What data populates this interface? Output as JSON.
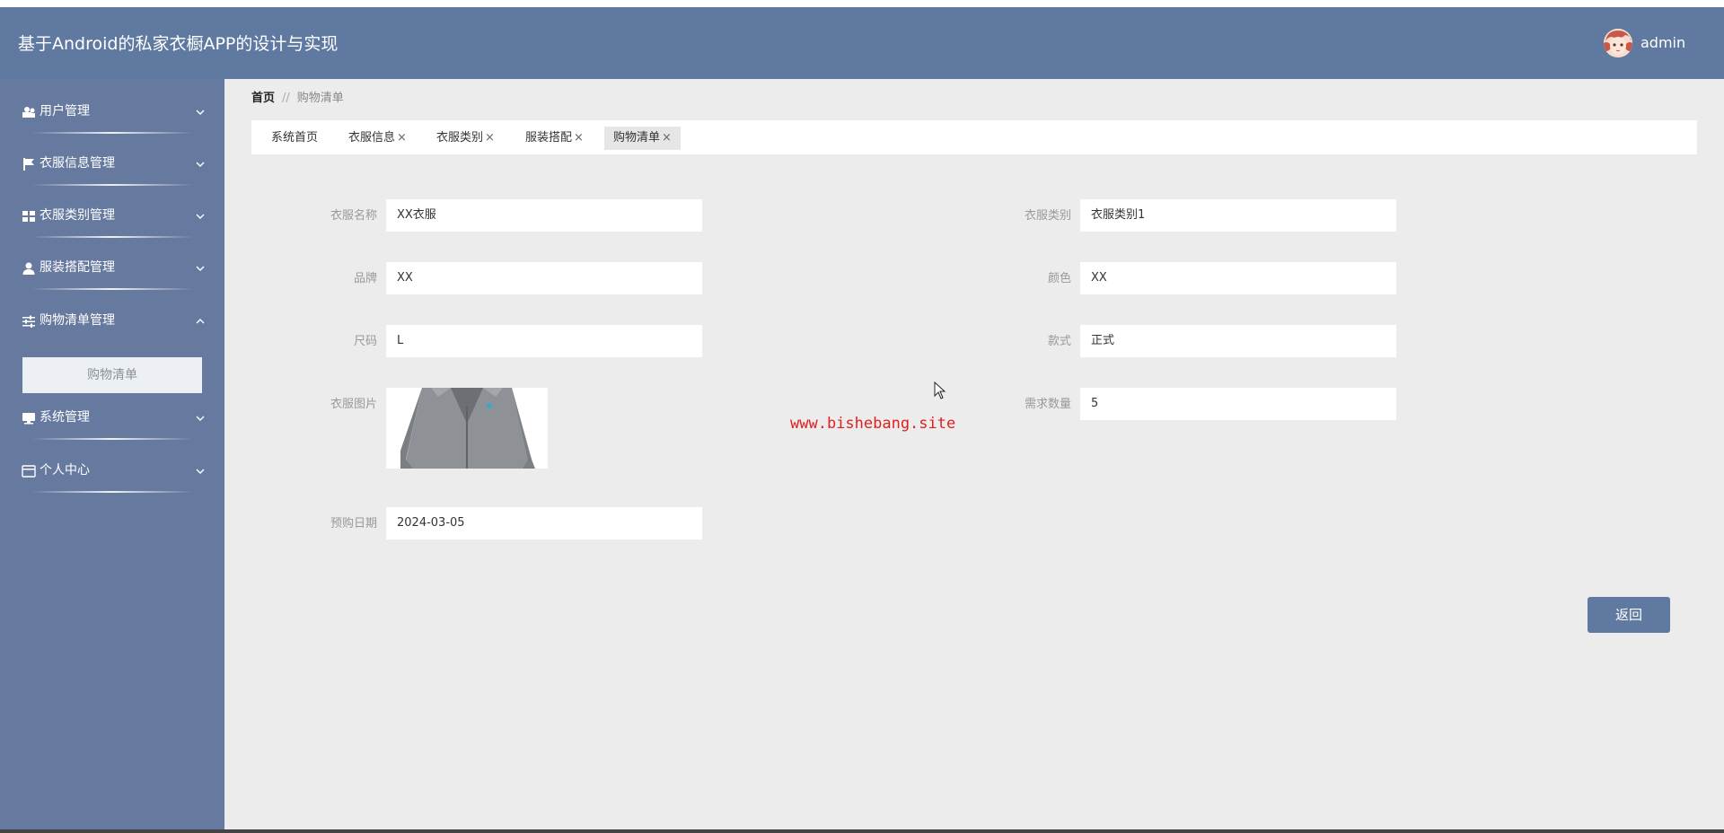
{
  "app": {
    "title": "基于Android的私家衣橱APP的设计与实现",
    "user": "admin"
  },
  "sidebar": {
    "items": [
      {
        "label": "用户管理",
        "icon": "user-group-icon",
        "expanded": false
      },
      {
        "label": "衣服信息管理",
        "icon": "flag-icon",
        "expanded": false
      },
      {
        "label": "衣服类别管理",
        "icon": "grid-icon",
        "expanded": false
      },
      {
        "label": "服装搭配管理",
        "icon": "person-icon",
        "expanded": false
      },
      {
        "label": "购物清单管理",
        "icon": "sliders-icon",
        "expanded": true
      },
      {
        "label": "系统管理",
        "icon": "monitor-icon",
        "expanded": false
      },
      {
        "label": "个人中心",
        "icon": "card-icon",
        "expanded": false
      }
    ],
    "submenu": {
      "label": "购物清单"
    }
  },
  "breadcrumb": {
    "home": "首页",
    "separator": "//",
    "current": "购物清单"
  },
  "tabs": [
    {
      "label": "系统首页",
      "closable": false
    },
    {
      "label": "衣服信息",
      "closable": true
    },
    {
      "label": "衣服类别",
      "closable": true
    },
    {
      "label": "服装搭配",
      "closable": true
    },
    {
      "label": "购物清单",
      "closable": true,
      "active": true
    }
  ],
  "tab_close_glyph": "×",
  "form": {
    "name": {
      "label": "衣服名称",
      "value": "XX衣服"
    },
    "category": {
      "label": "衣服类别",
      "value": "衣服类别1"
    },
    "brand": {
      "label": "品牌",
      "value": "XX"
    },
    "color": {
      "label": "颜色",
      "value": "XX"
    },
    "size": {
      "label": "尺码",
      "value": "L"
    },
    "style": {
      "label": "款式",
      "value": "正式"
    },
    "image": {
      "label": "衣服图片"
    },
    "quantity": {
      "label": "需求数量",
      "value": "5"
    },
    "date": {
      "label": "预购日期",
      "value": "2024-03-05"
    }
  },
  "watermark": "www.bishebang.site",
  "buttons": {
    "back": "返回"
  },
  "colors": {
    "header": "#6079a0",
    "sidebar": "#66799f",
    "main_bg": "#ececec",
    "accent": "#6079a0",
    "watermark": "#e01f1f"
  }
}
